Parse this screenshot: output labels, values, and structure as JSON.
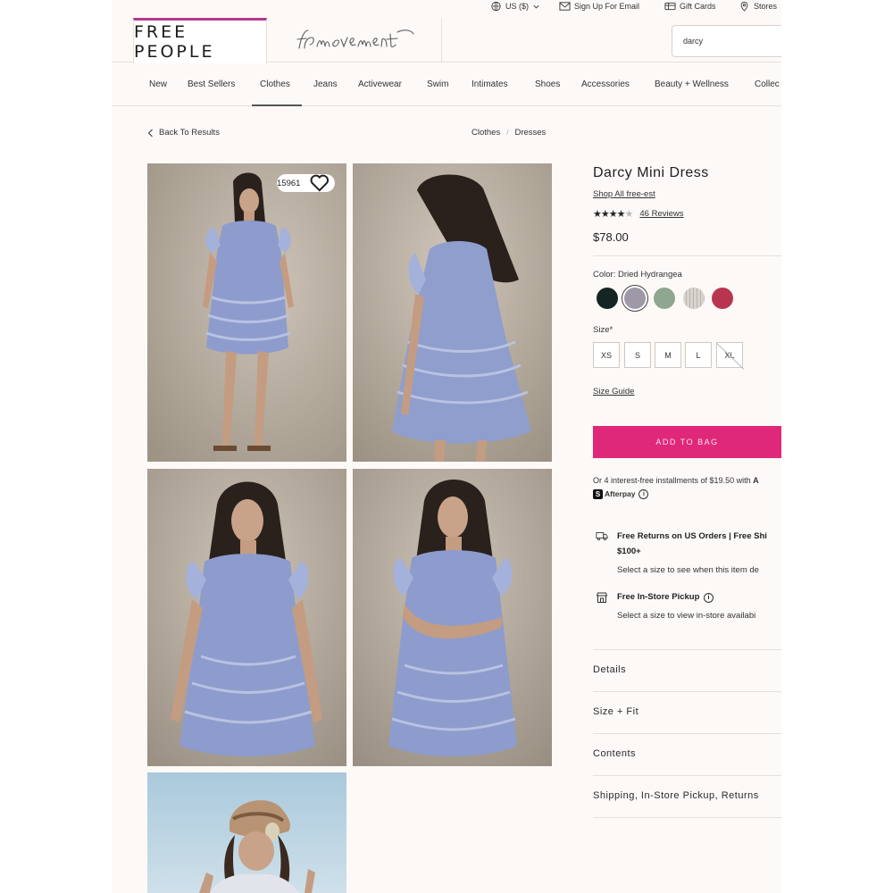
{
  "utility": {
    "region": "US ($)",
    "signup": "Sign Up For Email",
    "gift": "Gift Cards",
    "stores": "Stores"
  },
  "brand": {
    "logo": "FREE PEOPLE",
    "sub_logo": "fpmovement",
    "accent": "#b43a8c"
  },
  "search": {
    "value": "darcy"
  },
  "nav": {
    "items": [
      "New",
      "Best Sellers",
      "Clothes",
      "Jeans",
      "Activewear",
      "Swim",
      "Intimates",
      "Shoes",
      "Accessories",
      "Beauty + Wellness",
      "Collec"
    ],
    "active": "Clothes"
  },
  "breadcrumb": {
    "back": "Back To Results",
    "items": [
      "Clothes",
      "Dresses"
    ]
  },
  "gallery": {
    "favorites": "15961"
  },
  "product": {
    "title": "Darcy Mini Dress",
    "shop_all": "Shop All free-est",
    "rating": 4,
    "reviews": "46 Reviews",
    "price": "$78.00",
    "color_label": "Color: Dried Hydrangea",
    "swatches": [
      "#142523",
      "#9f98a6",
      "#8fa68f",
      "#d2cfca",
      "#b8354f"
    ],
    "selected_swatch": 1,
    "size_label": "Size*",
    "sizes": [
      "XS",
      "S",
      "M",
      "L",
      "XL"
    ],
    "unavailable_size": "XL",
    "size_guide": "Size Guide",
    "add_to_bag": "ADD TO BAG",
    "add_color": "#e0287a",
    "installments": "Or 4 interest-free installments of $19.50 with",
    "installments_trail": "A",
    "afterpay": "Afterpay"
  },
  "services": {
    "returns_title": "Free Returns on US Orders | Free Shi",
    "returns_title2": "$100+",
    "returns_sub": "Select a size to see when this item de",
    "pickup_title": "Free In-Store Pickup",
    "pickup_sub": "Select a size to view in-store availabi"
  },
  "accordions": [
    "Details",
    "Size + Fit",
    "Contents",
    "Shipping, In-Store Pickup, Returns"
  ]
}
